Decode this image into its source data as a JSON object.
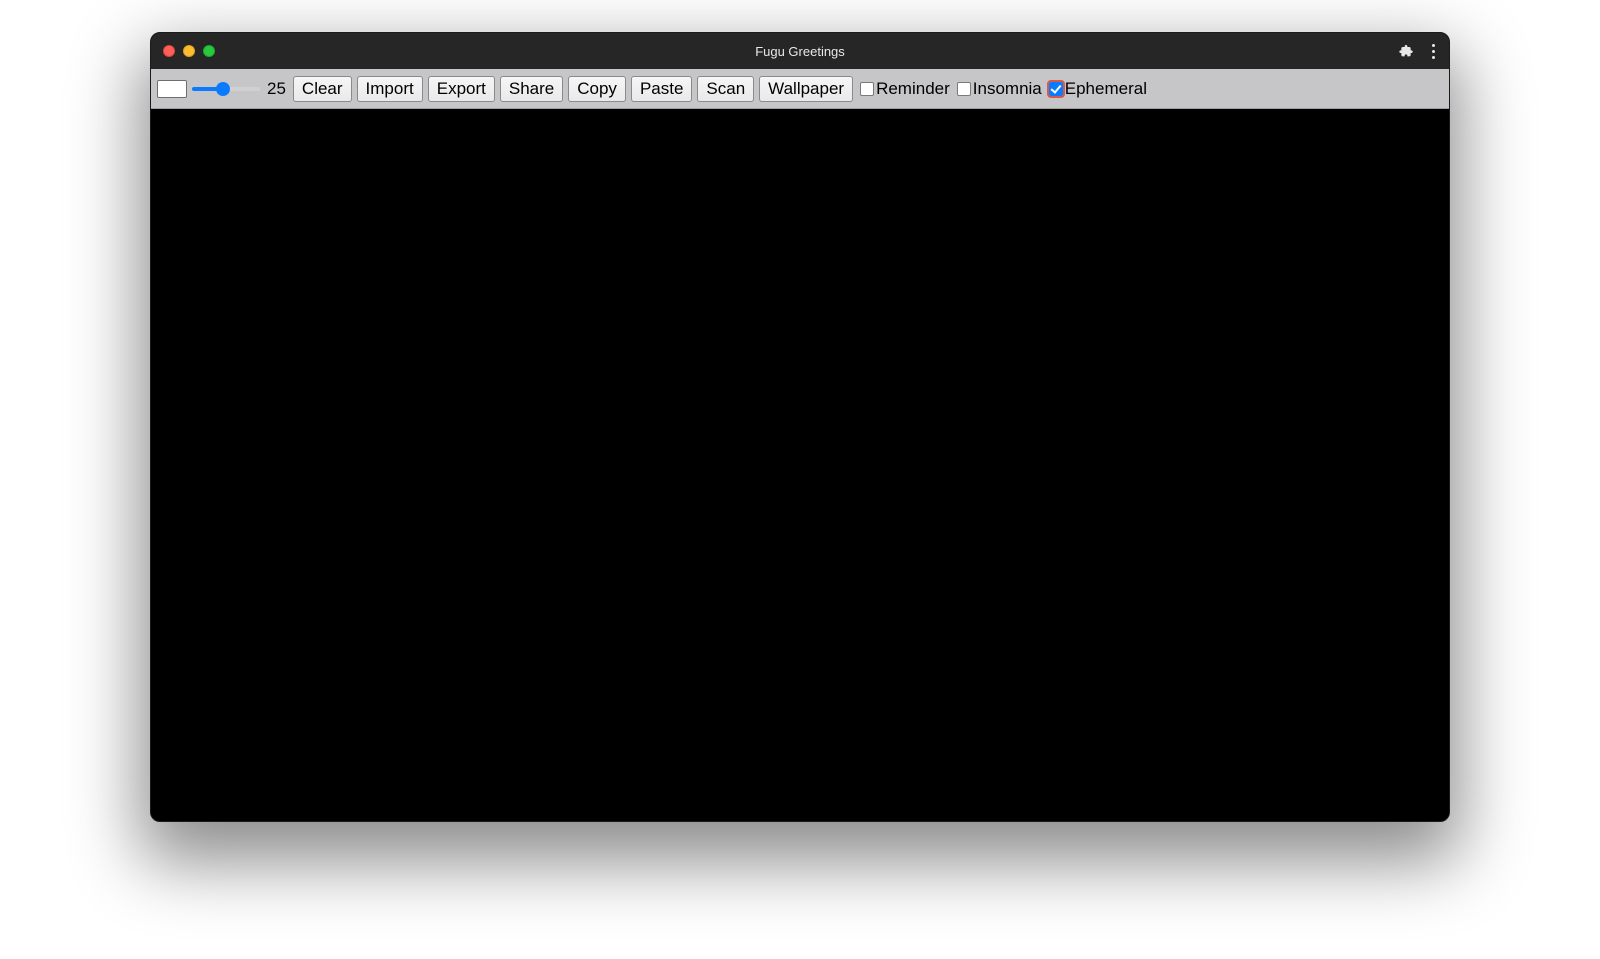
{
  "window": {
    "title": "Fugu Greetings"
  },
  "toolbar": {
    "size_value": "25",
    "buttons": {
      "clear": "Clear",
      "import": "Import",
      "export": "Export",
      "share": "Share",
      "copy": "Copy",
      "paste": "Paste",
      "scan": "Scan",
      "wallpaper": "Wallpaper"
    },
    "checkboxes": {
      "reminder": {
        "label": "Reminder",
        "checked": false
      },
      "insomnia": {
        "label": "Insomnia",
        "checked": false
      },
      "ephemeral": {
        "label": "Ephemeral",
        "checked": true
      }
    },
    "slider_percent": 45,
    "color": "#ffffff"
  }
}
